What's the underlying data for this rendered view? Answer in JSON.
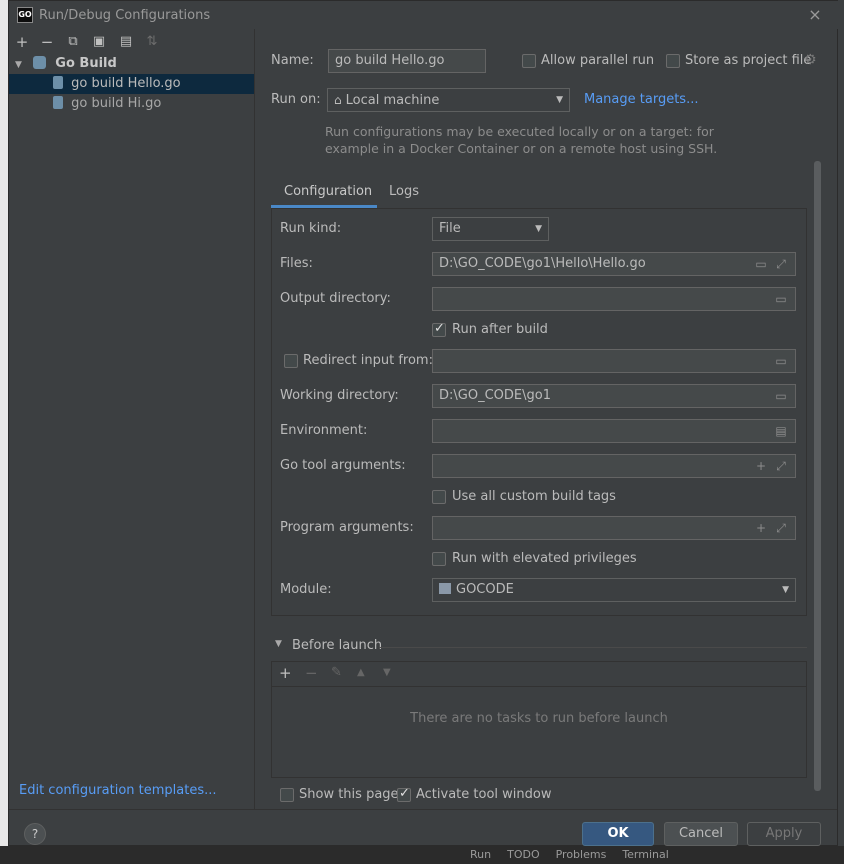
{
  "window": {
    "title": "Run/Debug Configurations",
    "app_icon": "GO",
    "close_icon": "×"
  },
  "toolbar": {
    "add_icon": "+",
    "remove_icon": "−",
    "copy_icon": "⧉",
    "save_icon": "▣",
    "folder_icon": "▤",
    "sort_icon": "⇅"
  },
  "tree": {
    "group_label": "Go Build",
    "items": [
      {
        "label": "go build Hello.go"
      },
      {
        "label": "go build Hi.go"
      }
    ]
  },
  "left_footer": {
    "templates_link": "Edit configuration templates..."
  },
  "form": {
    "name_label": "Name:",
    "name_value": "go build Hello.go",
    "allow_parallel_label": "Allow parallel run",
    "store_project_label": "Store as project file",
    "run_on_label": "Run on:",
    "run_on_value": "Local machine",
    "manage_targets": "Manage targets...",
    "help_line1": "Run configurations may be executed locally or on a target: for",
    "help_line2": "example in a Docker Container or on a remote host using SSH."
  },
  "tabs": [
    {
      "label": "Configuration"
    },
    {
      "label": "Logs"
    }
  ],
  "config": {
    "run_kind_label": "Run kind:",
    "run_kind_value": "File",
    "files_label": "Files:",
    "files_value": "D:\\GO_CODE\\go1\\Hello\\Hello.go",
    "output_dir_label": "Output directory:",
    "output_dir_value": "",
    "run_after_build_label": "Run after build",
    "redirect_input_label": "Redirect input from:",
    "redirect_input_value": "",
    "working_dir_label": "Working directory:",
    "working_dir_value": "D:\\GO_CODE\\go1",
    "environment_label": "Environment:",
    "environment_value": "",
    "go_tool_args_label": "Go tool arguments:",
    "go_tool_args_value": "",
    "custom_build_tags_label": "Use all custom build tags",
    "program_args_label": "Program arguments:",
    "program_args_value": "",
    "elevated_label": "Run with elevated privileges",
    "module_label": "Module:",
    "module_value": "GOCODE"
  },
  "before_launch": {
    "title": "Before launch",
    "add_icon": "+",
    "remove_icon": "−",
    "edit_icon": "✎",
    "up_icon": "▲",
    "down_icon": "▼",
    "empty_text": "There are no tasks to run before launch"
  },
  "footer": {
    "show_page_label": "Show this page",
    "activate_tool_label": "Activate tool window",
    "help_label": "?",
    "ok_label": "OK",
    "cancel_label": "Cancel",
    "apply_label": "Apply"
  },
  "background_tabs": {
    "run": "Run",
    "todo": "TODO",
    "problems": "Problems",
    "terminal": "Terminal"
  },
  "colors": {
    "dialog_bg": "#3c3f41",
    "selection": "#0d293e",
    "accent": "#4a88c7",
    "link": "#589df6",
    "primary_button": "#365880"
  }
}
